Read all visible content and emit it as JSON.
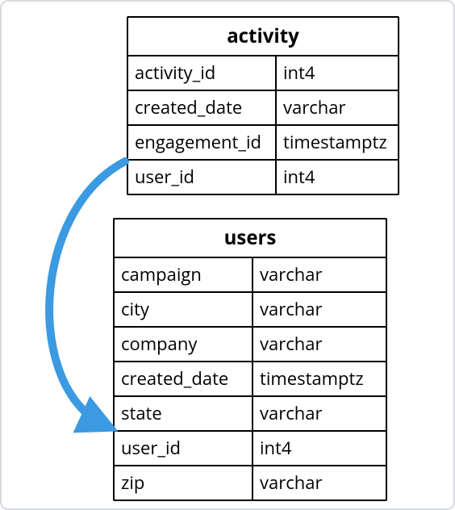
{
  "tables": [
    {
      "id": "activity",
      "name": "activity",
      "columns": [
        {
          "name": "activity_id",
          "type": "int4"
        },
        {
          "name": "created_date",
          "type": "varchar"
        },
        {
          "name": "engagement_id",
          "type": "timestamptz"
        },
        {
          "name": "user_id",
          "type": "int4"
        }
      ]
    },
    {
      "id": "users",
      "name": "users",
      "columns": [
        {
          "name": "campaign",
          "type": "varchar"
        },
        {
          "name": "city",
          "type": "varchar"
        },
        {
          "name": "company",
          "type": "varchar"
        },
        {
          "name": "created_date",
          "type": "timestamptz"
        },
        {
          "name": "state",
          "type": "varchar"
        },
        {
          "name": "user_id",
          "type": "int4"
        },
        {
          "name": "zip",
          "type": "varchar"
        }
      ]
    }
  ],
  "relation": {
    "from": "activity.user_id",
    "to": "users.user_id",
    "arrow_color": "#3b9ae1"
  }
}
